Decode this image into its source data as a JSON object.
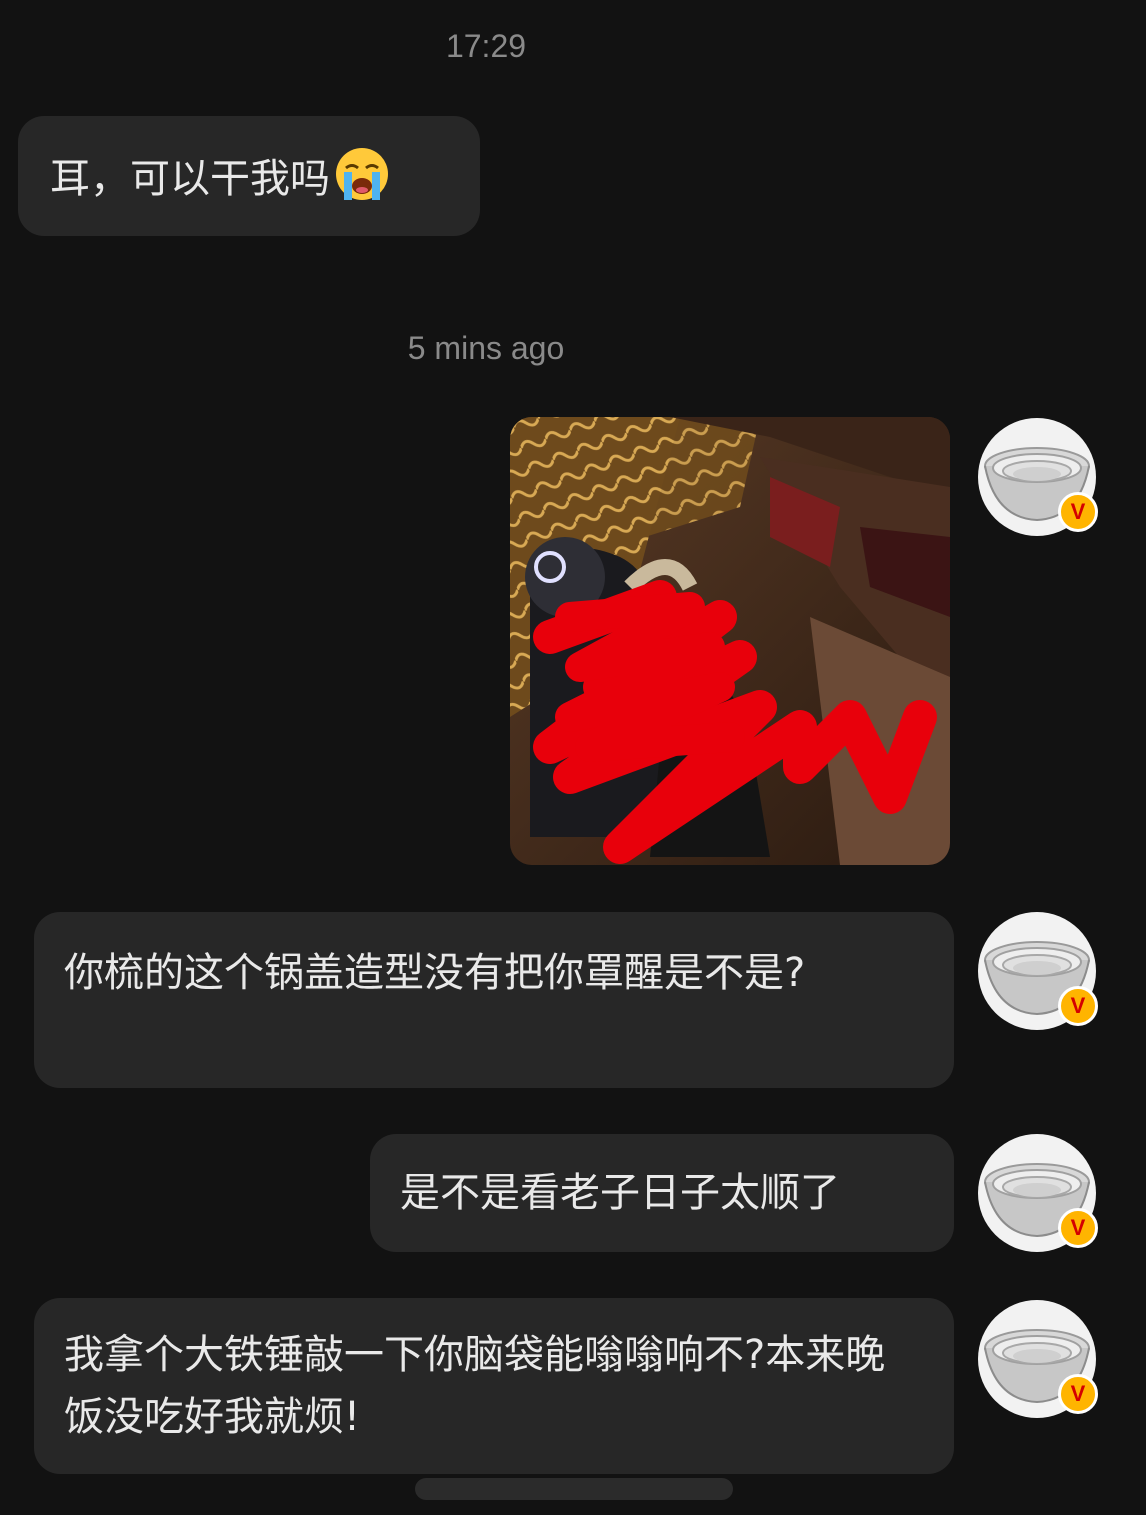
{
  "timestamps": {
    "first": "17:29",
    "second": "5 mins ago"
  },
  "messages": [
    {
      "id": "m1",
      "side": "left",
      "text": "耳，可以干我吗",
      "emoji": "loudly-crying-face"
    },
    {
      "id": "m2",
      "side": "right",
      "type": "image",
      "content": "redacted-photo"
    },
    {
      "id": "m3",
      "side": "right",
      "text": "你梳的这个锅盖造型没有把你罩醒是不是?"
    },
    {
      "id": "m4",
      "side": "right",
      "text": "是不是看老子日子太顺了"
    },
    {
      "id": "m5",
      "side": "right",
      "text": "我拿个大铁锤敲一下你脑袋能嗡嗡响不?本来晚饭没吃好我就烦!"
    }
  ],
  "avatar": {
    "icon": "bowl-avatar-icon",
    "badge": "verified-badge-icon",
    "badge_color": "#ffb400",
    "badge_label": "V"
  },
  "colors": {
    "background": "#121212",
    "bubble": "#272727",
    "text": "#e9e9e9",
    "timestamp": "#8a8a8a",
    "redaction": "#e8000b"
  }
}
